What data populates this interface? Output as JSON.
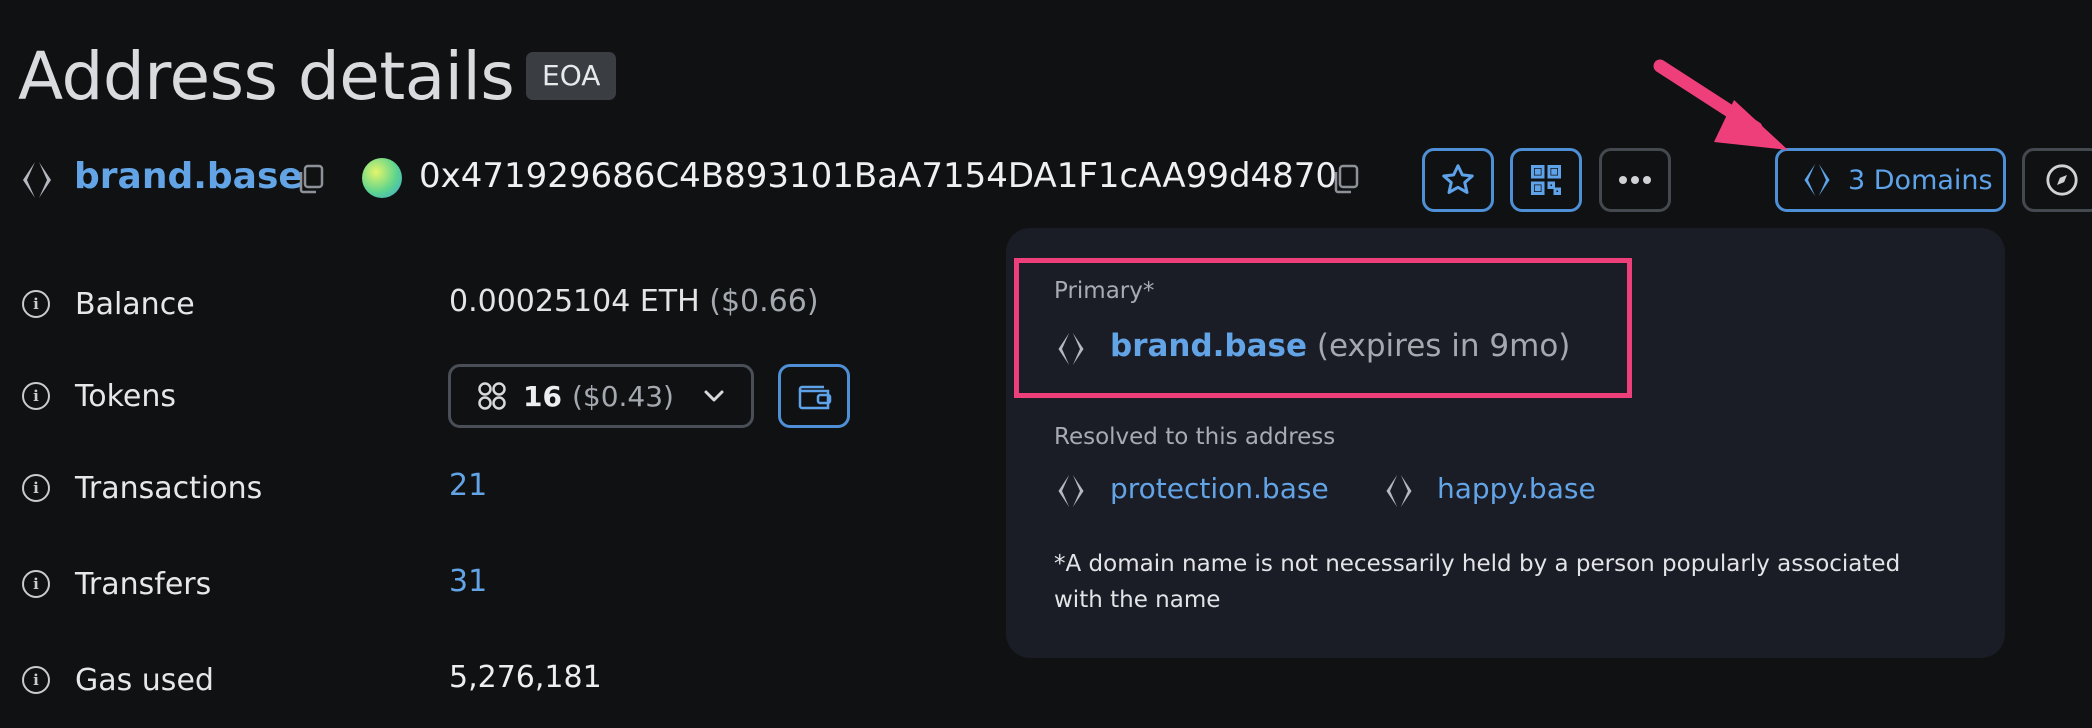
{
  "header": {
    "title": "Address details",
    "badge": "EOA"
  },
  "address_bar": {
    "ens_name": "brand.base",
    "address": "0x471929686C4B893101BaA7154DA1F1cAA99d4870",
    "domains_button": "3 Domains"
  },
  "details": [
    {
      "label": "Balance",
      "value": "0.00025104 ETH",
      "secondary": "($0.66)"
    },
    {
      "label": "Tokens",
      "count": "16",
      "secondary": "($0.43)"
    },
    {
      "label": "Transactions",
      "value": "21"
    },
    {
      "label": "Transfers",
      "value": "31"
    },
    {
      "label": "Gas used",
      "value": "5,276,181"
    }
  ],
  "popover": {
    "primary_label": "Primary*",
    "primary_name": "brand.base",
    "primary_expiry": "(expires in 9mo)",
    "resolved_label": "Resolved to this address",
    "resolved": [
      "protection.base",
      "happy.base"
    ],
    "footnote": "*A domain name is not necessarily held by a person popularly associated with the name"
  },
  "colors": {
    "background": "#101112",
    "link": "#63a4e6",
    "popover": "#1a1c26",
    "annotation_pink": "#ee3f7b"
  },
  "icons": [
    "ens-logo-icon",
    "copy-icon",
    "avatar-gradient",
    "star-icon",
    "qr-code-icon",
    "more-dots-icon",
    "compass-icon",
    "info-icon",
    "tokens-grid-icon",
    "chevron-down-icon",
    "wallet-icon",
    "annotation-arrow"
  ]
}
